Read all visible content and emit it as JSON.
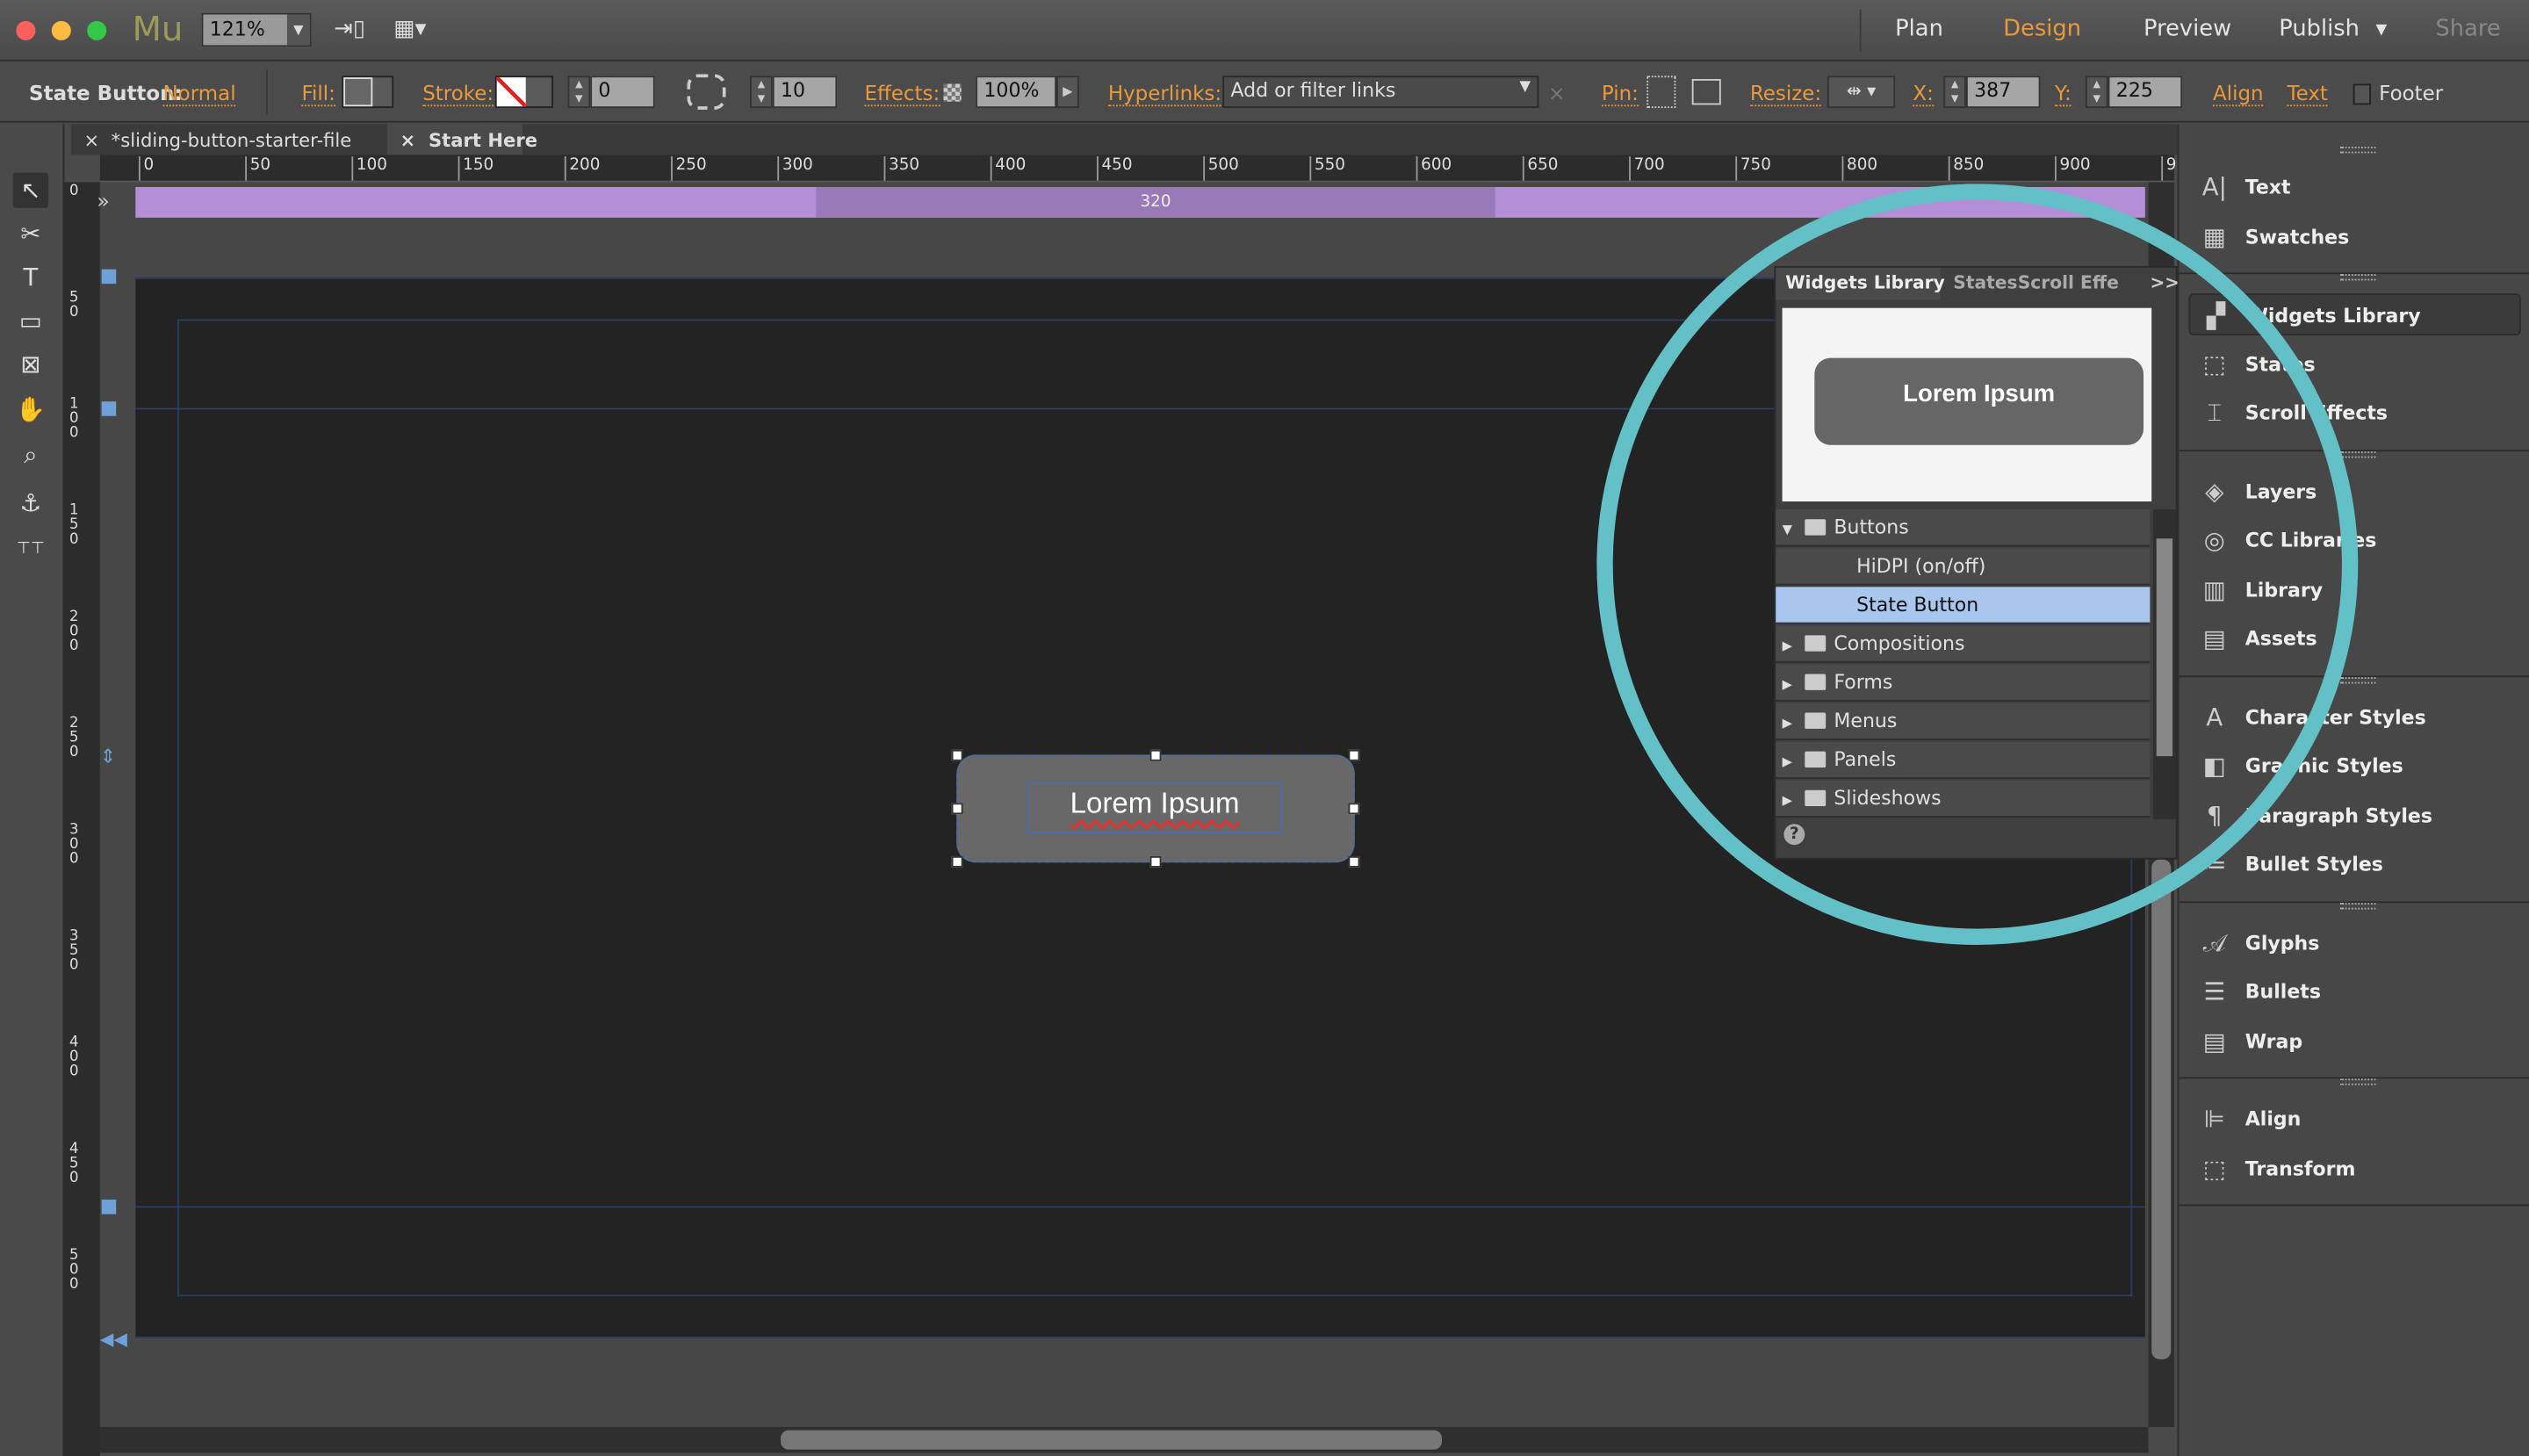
{
  "titlebar": {
    "app_logo": "Mu",
    "zoom": "121%",
    "nav": [
      "Plan",
      "Design",
      "Preview",
      "Publish",
      "Share"
    ],
    "active_nav": "Design",
    "publish_arrow": "▼"
  },
  "control": {
    "selection_label": "State Button:",
    "state": "Normal",
    "fill": "Fill:",
    "stroke": "Stroke:",
    "stroke_width": "0",
    "corner_radius": "10",
    "effects": "Effects:",
    "opacity": "100%",
    "hyperlinks": "Hyperlinks:",
    "hyperlinks_placeholder": "Add or filter links",
    "pin": "Pin:",
    "resize": "Resize:",
    "x_label": "X:",
    "x": "387",
    "y_label": "Y:",
    "y": "225",
    "align": "Align",
    "text": "Text",
    "footer": "Footer"
  },
  "tabs": [
    {
      "label": "*sliding-button-starter-file",
      "close": "×"
    },
    {
      "label": "Start Here",
      "close": "×"
    }
  ],
  "ruler": {
    "h": [
      "0",
      "50",
      "100",
      "150",
      "200",
      "250",
      "300",
      "350",
      "400",
      "450",
      "500",
      "550",
      "600",
      "650",
      "700",
      "750",
      "800",
      "850",
      "900",
      "95"
    ],
    "v": [
      "0",
      "50",
      "100",
      "150",
      "200",
      "250",
      "300",
      "350",
      "400",
      "450",
      "500"
    ]
  },
  "breakpoint": "320",
  "canvas": {
    "button_text": "Lorem Ipsum"
  },
  "widgets_panel": {
    "tabs": [
      "Widgets Library",
      "States",
      "Scroll Effe"
    ],
    "more": ">>",
    "preview_text": "Lorem Ipsum",
    "help": "?",
    "rows": [
      {
        "label": "Buttons",
        "type": "folder-open"
      },
      {
        "label": "HiDPI (on/off)",
        "type": "item"
      },
      {
        "label": "State Button",
        "type": "item",
        "selected": true
      },
      {
        "label": "Compositions",
        "type": "folder"
      },
      {
        "label": "Forms",
        "type": "folder"
      },
      {
        "label": "Menus",
        "type": "folder"
      },
      {
        "label": "Panels",
        "type": "folder"
      },
      {
        "label": "Slideshows",
        "type": "folder"
      }
    ]
  },
  "right_panel": {
    "groups": [
      [
        {
          "label": "Text",
          "icon": "A|"
        },
        {
          "label": "Swatches",
          "icon": "▦"
        }
      ],
      [
        {
          "label": "Widgets Library",
          "icon": "▞",
          "active": true
        },
        {
          "label": "States",
          "icon": "⬚"
        },
        {
          "label": "Scroll Effects",
          "icon": "⌶"
        }
      ],
      [
        {
          "label": "Layers",
          "icon": "◈"
        },
        {
          "label": "CC Libraries",
          "icon": "◎"
        },
        {
          "label": "Library",
          "icon": "▥"
        },
        {
          "label": "Assets",
          "icon": "▤"
        }
      ],
      [
        {
          "label": "Character Styles",
          "icon": "A"
        },
        {
          "label": "Graphic Styles",
          "icon": "◧"
        },
        {
          "label": "Paragraph Styles",
          "icon": "¶"
        },
        {
          "label": "Bullet Styles",
          "icon": "≔"
        }
      ],
      [
        {
          "label": "Glyphs",
          "icon": "𝒜"
        },
        {
          "label": "Bullets",
          "icon": "☰"
        },
        {
          "label": "Wrap",
          "icon": "▤"
        }
      ],
      [
        {
          "label": "Align",
          "icon": "⊫"
        },
        {
          "label": "Transform",
          "icon": "⬚"
        }
      ]
    ]
  },
  "colors": {
    "accent": "#e89a3c",
    "highlight_circle": "#62c0c6",
    "selection": "#a9c6ee",
    "breakpoint_bar": "#b48ed6"
  }
}
